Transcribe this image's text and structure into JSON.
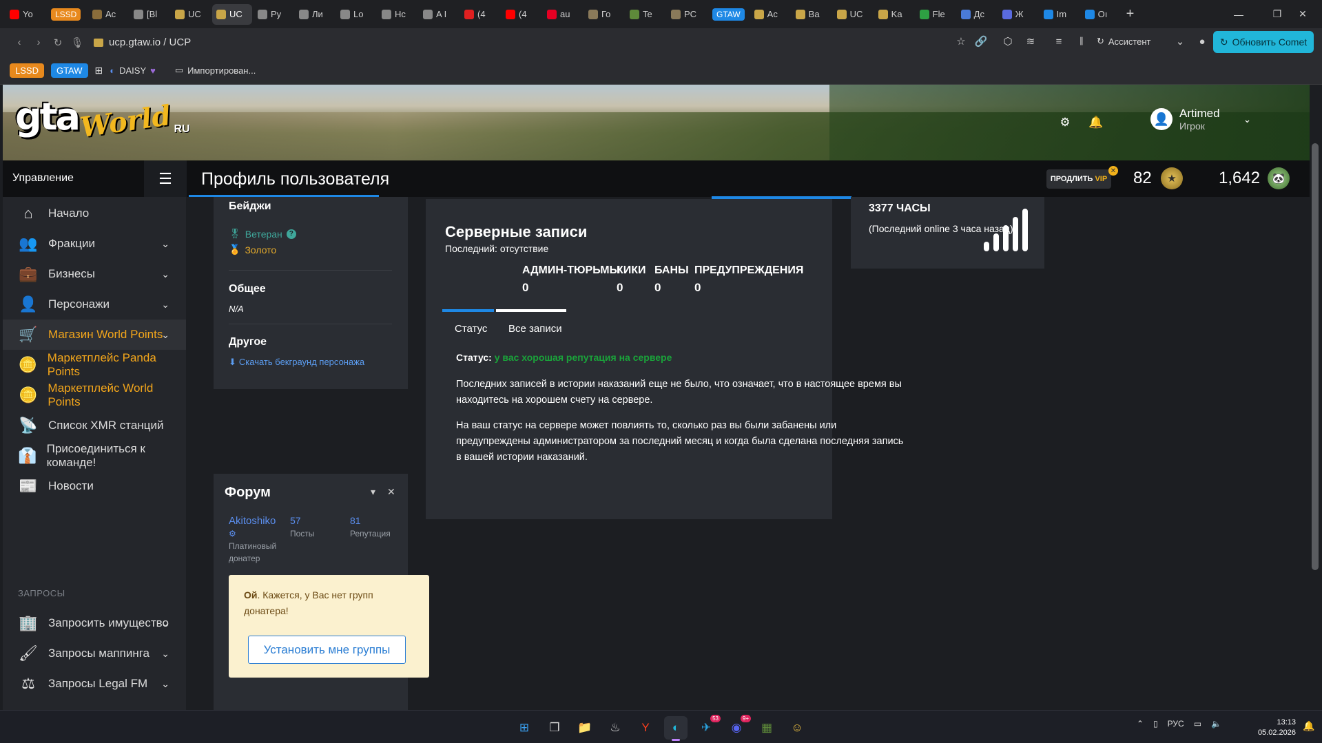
{
  "browser": {
    "tabs": [
      {
        "label": "Yo",
        "color": "#ff0000",
        "pill": false
      },
      {
        "label": "LSSD",
        "color": "#e8891d",
        "pill": true
      },
      {
        "label": "Ac",
        "color": "#8a6d3b",
        "pill": false
      },
      {
        "label": "[Bl",
        "color": "#888888",
        "pill": false
      },
      {
        "label": "UC",
        "color": "#c9a648",
        "pill": false
      },
      {
        "label": "UC",
        "color": "#c9a648",
        "pill": false,
        "active": true
      },
      {
        "label": "Py",
        "color": "#888888",
        "pill": false
      },
      {
        "label": "Ли",
        "color": "#888888",
        "pill": false
      },
      {
        "label": "Lo",
        "color": "#888888",
        "pill": false
      },
      {
        "label": "Hc",
        "color": "#888888",
        "pill": false
      },
      {
        "label": "A I",
        "color": "#888888",
        "pill": false
      },
      {
        "label": "(4",
        "color": "#e02020",
        "pill": false
      },
      {
        "label": "(4",
        "color": "#ff0000",
        "pill": false
      },
      {
        "label": "au",
        "color": "#e60023",
        "pill": false
      },
      {
        "label": "Го",
        "color": "#8a7a5a",
        "pill": false
      },
      {
        "label": "Te",
        "color": "#5e8a3a",
        "pill": false
      },
      {
        "label": "PC",
        "color": "#8a7a5a",
        "pill": false
      },
      {
        "label": "GTAW",
        "color": "#1e88e5",
        "pill": true
      },
      {
        "label": "Ac",
        "color": "#c9a648",
        "pill": false
      },
      {
        "label": "Ba",
        "color": "#c9a648",
        "pill": false
      },
      {
        "label": "UC",
        "color": "#c9a648",
        "pill": false
      },
      {
        "label": "Ka",
        "color": "#c9a648",
        "pill": false
      },
      {
        "label": "Fle",
        "color": "#2ea043",
        "pill": false
      },
      {
        "label": "Дс",
        "color": "#4a7bd8",
        "pill": false
      },
      {
        "label": "Ж",
        "color": "#5a6be0",
        "pill": false
      },
      {
        "label": "Im",
        "color": "#1e88e5",
        "pill": false
      },
      {
        "label": "Oı",
        "color": "#1e88e5",
        "pill": false
      }
    ],
    "url": "ucp.gtaw.io / UCP",
    "assistant_label": "Ассистент",
    "update_label": "Обновить Comet",
    "bookmarks": {
      "lssd": "LSSD",
      "gtaw": "GTAW",
      "daisy": "DAISY",
      "imported": "Импортирован..."
    }
  },
  "site": {
    "logo": {
      "gta": "gta",
      "world": "World",
      "ru": "RU"
    },
    "user": {
      "name": "Artimed",
      "role": "Игрок"
    },
    "management_label": "Управление",
    "page_title": "Профиль пользователя",
    "vip": {
      "prefix": "ПРОДЛИТЬ",
      "vip": "VIP"
    },
    "level": "82",
    "points": "1,642",
    "sidebar": {
      "items": [
        {
          "label": "Начало",
          "icon": "home-icon",
          "chevron": false,
          "gold": false
        },
        {
          "label": "Фракции",
          "icon": "users-icon",
          "chevron": true,
          "gold": false
        },
        {
          "label": "Бизнесы",
          "icon": "briefcase-icon",
          "chevron": true,
          "gold": false
        },
        {
          "label": "Персонажи",
          "icon": "user-icon",
          "chevron": true,
          "gold": false
        },
        {
          "label": "Магазин World Points",
          "icon": "cart-icon",
          "chevron": true,
          "gold": true,
          "active": true
        },
        {
          "label": "Маркетплейс Panda Points",
          "icon": "coins-icon",
          "chevron": false,
          "gold": true
        },
        {
          "label": "Маркетплейс World Points",
          "icon": "coins-icon",
          "chevron": false,
          "gold": true
        },
        {
          "label": "Список XMR станций",
          "icon": "broadcast-icon",
          "chevron": false,
          "gold": false
        },
        {
          "label": "Присоединиться к команде!",
          "icon": "user-tie-icon",
          "chevron": false,
          "gold": false
        },
        {
          "label": "Новости",
          "icon": "newspaper-icon",
          "chevron": false,
          "gold": false
        }
      ],
      "section_label": "ЗАПРОСЫ",
      "requests": [
        {
          "label": "Запросить имущество",
          "icon": "building-icon",
          "chevron": true
        },
        {
          "label": "Запросы маппинга",
          "icon": "brush-icon",
          "chevron": true
        },
        {
          "label": "Запросы Legal FM",
          "icon": "scales-icon",
          "chevron": true
        }
      ]
    },
    "profile": {
      "badges_title": "Бейджи",
      "badges": [
        {
          "label": "Ветеран",
          "kind": "vet"
        },
        {
          "label": "Золото",
          "kind": "gold"
        }
      ],
      "general_title": "Общее",
      "general_value": "N/A",
      "other_title": "Другое",
      "download_link": "Скачать бекграунд персонажа"
    },
    "forum": {
      "title": "Форум",
      "username": "Akitoshiko",
      "role": "Платиновый донатер",
      "posts": "57",
      "posts_label": "Посты",
      "reputation": "81",
      "reputation_label": "Репутация",
      "donor_text_bold": "Ой",
      "donor_text": ". Кажется, у Вас нет групп донатера!",
      "donor_button": "Установить мне группы"
    },
    "server": {
      "title": "Серверные записи",
      "last": "Последний: отсутствие",
      "counters": [
        {
          "label": "АДМИН-ТЮРЬМЫ",
          "value": "0"
        },
        {
          "label": "КИКИ",
          "value": "0"
        },
        {
          "label": "БАНЫ",
          "value": "0"
        },
        {
          "label": "ПРЕДУПРЕЖДЕНИЯ",
          "value": "0"
        }
      ],
      "tabs": [
        "Статус",
        "Все записи"
      ],
      "status_label": "Статус:",
      "status_value": "у вас хорошая репутация на сервере",
      "paragraph1": "Последних записей в истории наказаний еще не было, что означает, что в настоящее время вы находитесь на хорошем счету на сервере.",
      "paragraph2": "На ваш статус на сервере может повлиять то, сколько раз вы были забанены или предупреждены администратором за последний месяц и когда была сделана последняя запись в вашей истории наказаний."
    },
    "activity": {
      "hours": "3377 ЧАСЫ",
      "last_online": "(Последний online 3 часа назад)"
    }
  },
  "taskbar": {
    "apps": [
      "windows-start-icon",
      "task-view-icon",
      "file-explorer-icon",
      "steam-icon",
      "yandex-icon",
      "comet-icon",
      "telegram-icon",
      "discord-icon",
      "minecraft-icon",
      "emoji-app-icon"
    ],
    "telegram_badge": "53",
    "discord_badge": "9+",
    "lang": "РУС",
    "time": "13:13",
    "date": "05.02.2026"
  },
  "colors": {
    "accent": "#1e88e5",
    "gold": "#f3a61b",
    "status_good": "#1aa33a",
    "update_btn": "#21b6d9"
  }
}
